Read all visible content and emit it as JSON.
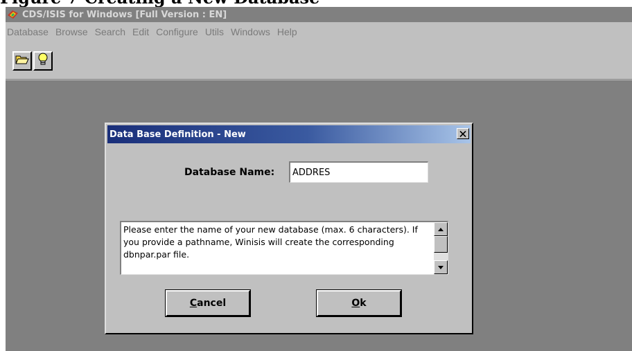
{
  "document": {
    "heading": "Figure 7 Creating a New Database"
  },
  "window": {
    "title": "CDS/ISIS for Windows [Full Version : EN]"
  },
  "menu": [
    "Database",
    "Browse",
    "Search",
    "Edit",
    "Configure",
    "Utils",
    "Windows",
    "Help"
  ],
  "toolbar": {
    "buttons": [
      {
        "icon": "open-folder-icon"
      },
      {
        "icon": "lightbulb-icon"
      }
    ]
  },
  "dialog": {
    "title": "Data Base Definition - New",
    "name_label": "Database Name:",
    "name_value": "ADDRES",
    "help_text": "Please enter the name of your new database (max. 6 characters). If you provide a pathname, Winisis will create the corresponding dbnpar.par file.",
    "cancel": {
      "accel": "C",
      "rest": "ancel"
    },
    "ok": {
      "accel": "O",
      "rest": "k"
    }
  },
  "colors": {
    "workspace": "#808080",
    "chrome": "#c0c0c0",
    "dialog_title_start": "#1a2f7a",
    "dialog_title_end": "#a8c4e8"
  }
}
